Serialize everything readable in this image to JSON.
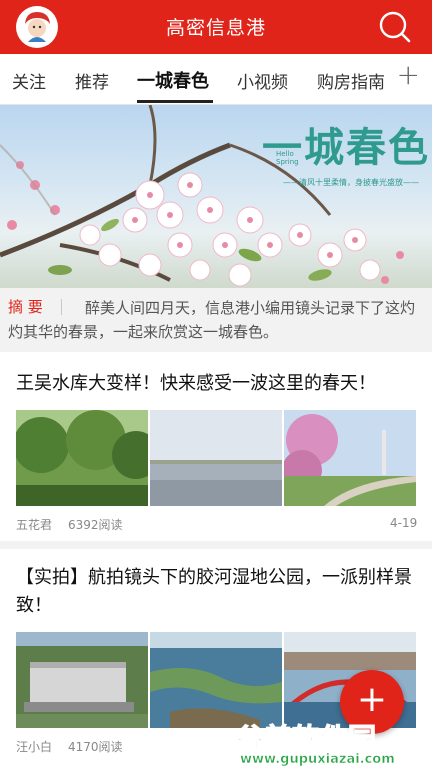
{
  "header": {
    "title": "高密信息港"
  },
  "tabs": [
    {
      "label": "关注"
    },
    {
      "label": "推荐"
    },
    {
      "label": "一城春色",
      "active": true
    },
    {
      "label": "小视频"
    },
    {
      "label": "购房指南"
    }
  ],
  "banner": {
    "title": "一城春色",
    "english": "Hello\nSpring",
    "subtitle": "——清风十里柔情，身披春光盛放——"
  },
  "summary": {
    "label": "摘 要",
    "text": "醉美人间四月天，信息港小编用镜头记录下了这灼灼其华的春景，一起来欣赏这一城春色。"
  },
  "articles": [
    {
      "title": "王吴水库大变样！快来感受一波这里的春天！",
      "author": "五花君",
      "reads": "6392阅读",
      "date": "4-19"
    },
    {
      "title": "【实拍】航拍镜头下的胶河湿地公园，一派别样景致！",
      "author": "汪小白",
      "reads": "4170阅读"
    }
  ],
  "watermark": {
    "brand": "谷普软件园",
    "url": "www.gupuxiazai.com"
  },
  "colors": {
    "brand_red": "#e0241a",
    "accent_teal": "#2f9a8e"
  }
}
